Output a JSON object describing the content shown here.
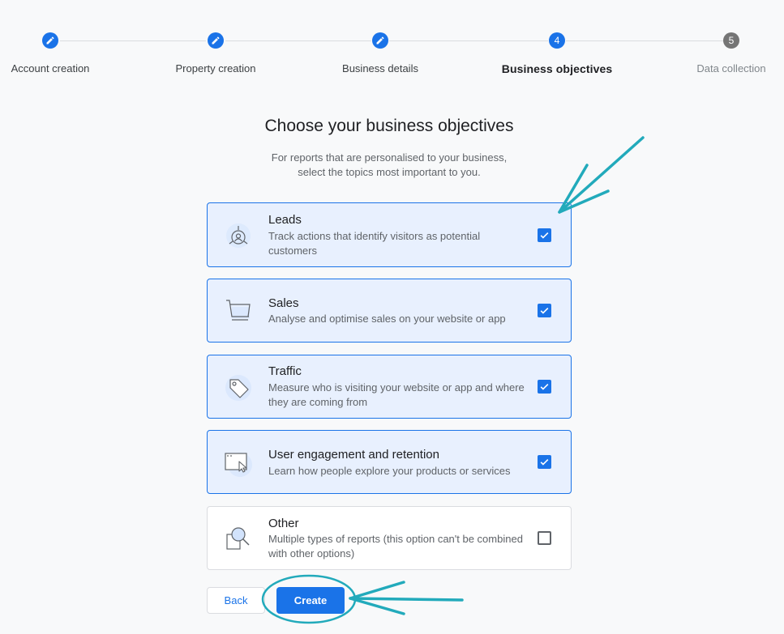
{
  "stepper": {
    "steps": [
      {
        "label": "Account creation",
        "marker": "edit-icon",
        "state": "done"
      },
      {
        "label": "Property creation",
        "marker": "edit-icon",
        "state": "done"
      },
      {
        "label": "Business details",
        "marker": "edit-icon",
        "state": "done"
      },
      {
        "label": "Business objectives",
        "marker": "4",
        "state": "active"
      },
      {
        "label": "Data collection",
        "marker": "5",
        "state": "pending"
      }
    ]
  },
  "main": {
    "title": "Choose your business objectives",
    "subtitle_line1": "For reports that are personalised to your business,",
    "subtitle_line2": "select the topics most important to you."
  },
  "options": [
    {
      "title": "Leads",
      "desc": "Track actions that identify visitors as potential customers",
      "checked": true,
      "icon": "leads-icon"
    },
    {
      "title": "Sales",
      "desc": "Analyse and optimise sales on your website or app",
      "checked": true,
      "icon": "shopping-cart-icon"
    },
    {
      "title": "Traffic",
      "desc": "Measure who is visiting your website or app and where they are coming from",
      "checked": true,
      "icon": "tag-icon"
    },
    {
      "title": "User engagement and retention",
      "desc": "Learn how people explore your products or services",
      "checked": true,
      "icon": "browser-cursor-icon"
    },
    {
      "title": "Other",
      "desc": "Multiple types of reports (this option can't be combined with other options)",
      "checked": false,
      "icon": "magnifier-icon"
    }
  ],
  "actions": {
    "back_label": "Back",
    "create_label": "Create"
  },
  "colors": {
    "accent": "#1a73e8",
    "selected_bg": "#e8f0fe",
    "annotation": "#22aabb"
  }
}
